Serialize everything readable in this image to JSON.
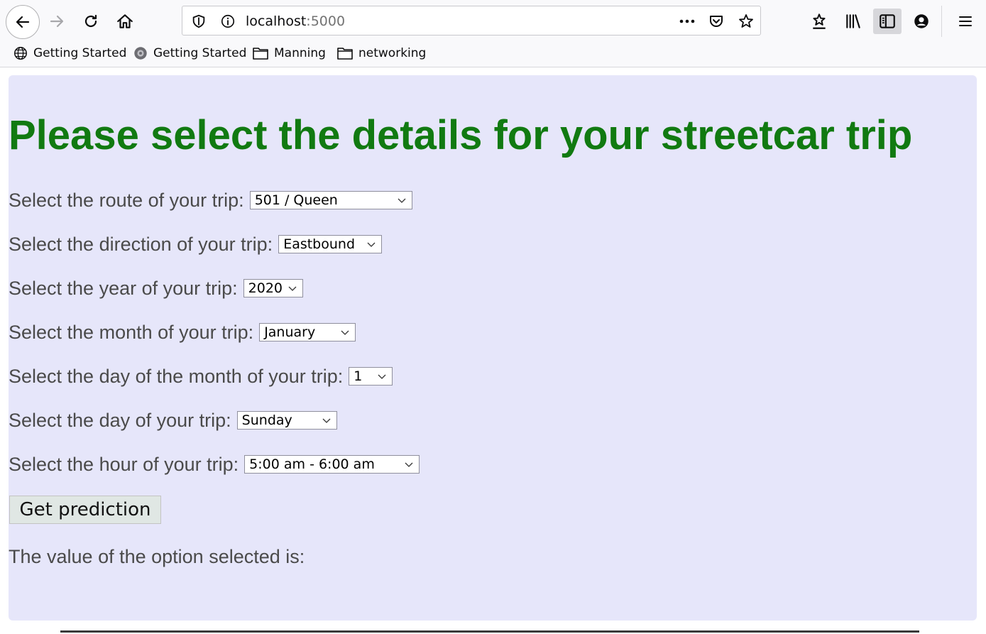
{
  "browser": {
    "url_host": "localhost",
    "url_port": ":5000",
    "bookmarks": [
      {
        "label": "Getting Started",
        "icon": "globe-icon"
      },
      {
        "label": "Getting Started",
        "icon": "firefox-icon"
      },
      {
        "label": "Manning",
        "icon": "folder-icon"
      },
      {
        "label": "networking",
        "icon": "folder-icon"
      }
    ]
  },
  "page": {
    "title": "Please select the details for your streetcar trip",
    "fields": [
      {
        "label": "Select the route of your trip:",
        "value": "501 / Queen"
      },
      {
        "label": "Select the direction of your trip:",
        "value": "Eastbound"
      },
      {
        "label": "Select the year of your trip:",
        "value": "2020"
      },
      {
        "label": "Select the month of your trip:",
        "value": "January"
      },
      {
        "label": "Select the day of the month of your trip:",
        "value": "1"
      },
      {
        "label": "Select the day of your trip:",
        "value": "Sunday"
      },
      {
        "label": "Select the hour of your trip:",
        "value": "5:00 am - 6:00 am"
      }
    ],
    "button_label": "Get prediction",
    "result_text": "The value of the option selected is:"
  },
  "colors": {
    "page_background": "#e6e6fa",
    "title": "#117a11"
  }
}
